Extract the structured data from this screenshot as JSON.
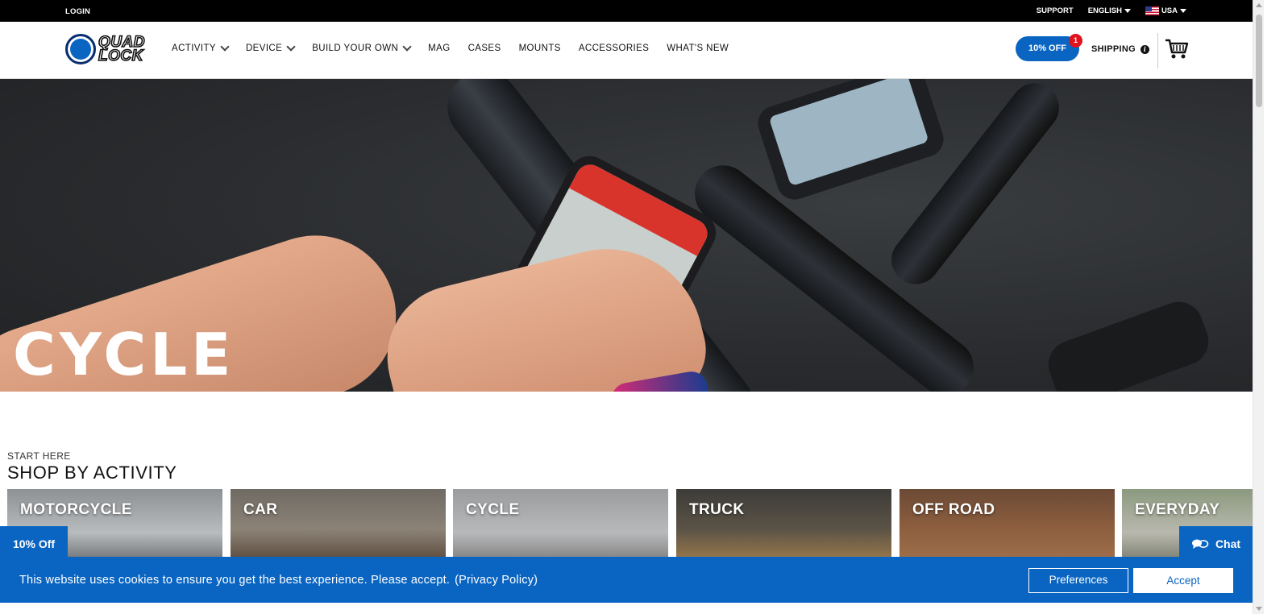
{
  "topbar": {
    "login": "LOGIN",
    "support": "SUPPORT",
    "language": "ENGLISH",
    "region": "USA"
  },
  "header": {
    "logo_top": "QUAD",
    "logo_bottom": "LOCK",
    "nav": [
      {
        "label": "ACTIVITY",
        "has_dropdown": true
      },
      {
        "label": "DEVICE",
        "has_dropdown": true
      },
      {
        "label": "BUILD YOUR OWN",
        "has_dropdown": true
      },
      {
        "label": "MAG",
        "has_dropdown": false
      },
      {
        "label": "CASES",
        "has_dropdown": false
      },
      {
        "label": "MOUNTS",
        "has_dropdown": false
      },
      {
        "label": "ACCESSORIES",
        "has_dropdown": false
      },
      {
        "label": "WHAT'S NEW",
        "has_dropdown": false
      }
    ],
    "promo_label": "10% OFF",
    "promo_badge": "1",
    "shipping_label": "SHIPPING",
    "info_glyph": "i"
  },
  "hero": {
    "title": "CYCLE"
  },
  "activity": {
    "kicker": "START HERE",
    "title": "SHOP BY ACTIVITY",
    "tiles": [
      {
        "label": "MOTORCYCLE"
      },
      {
        "label": "CAR"
      },
      {
        "label": "CYCLE"
      },
      {
        "label": "TRUCK"
      },
      {
        "label": "OFF ROAD"
      },
      {
        "label": "EVERYDAY"
      }
    ]
  },
  "floating": {
    "discount_tab": "10% Off",
    "chat_label": "Chat"
  },
  "cookie": {
    "message": "This website uses cookies to ensure you get the best experience. Please accept.",
    "policy_link": "(Privacy Policy)",
    "preferences": "Preferences",
    "accept": "Accept"
  },
  "colors": {
    "brand_blue": "#0a65c2",
    "badge_red": "#e0141e",
    "topbar_black": "#000000"
  },
  "icons": {
    "cart": "cart-icon",
    "chat": "chat-bubbles-icon",
    "info": "info-icon",
    "flag": "us-flag-icon",
    "dropdown": "chevron-down-icon"
  }
}
